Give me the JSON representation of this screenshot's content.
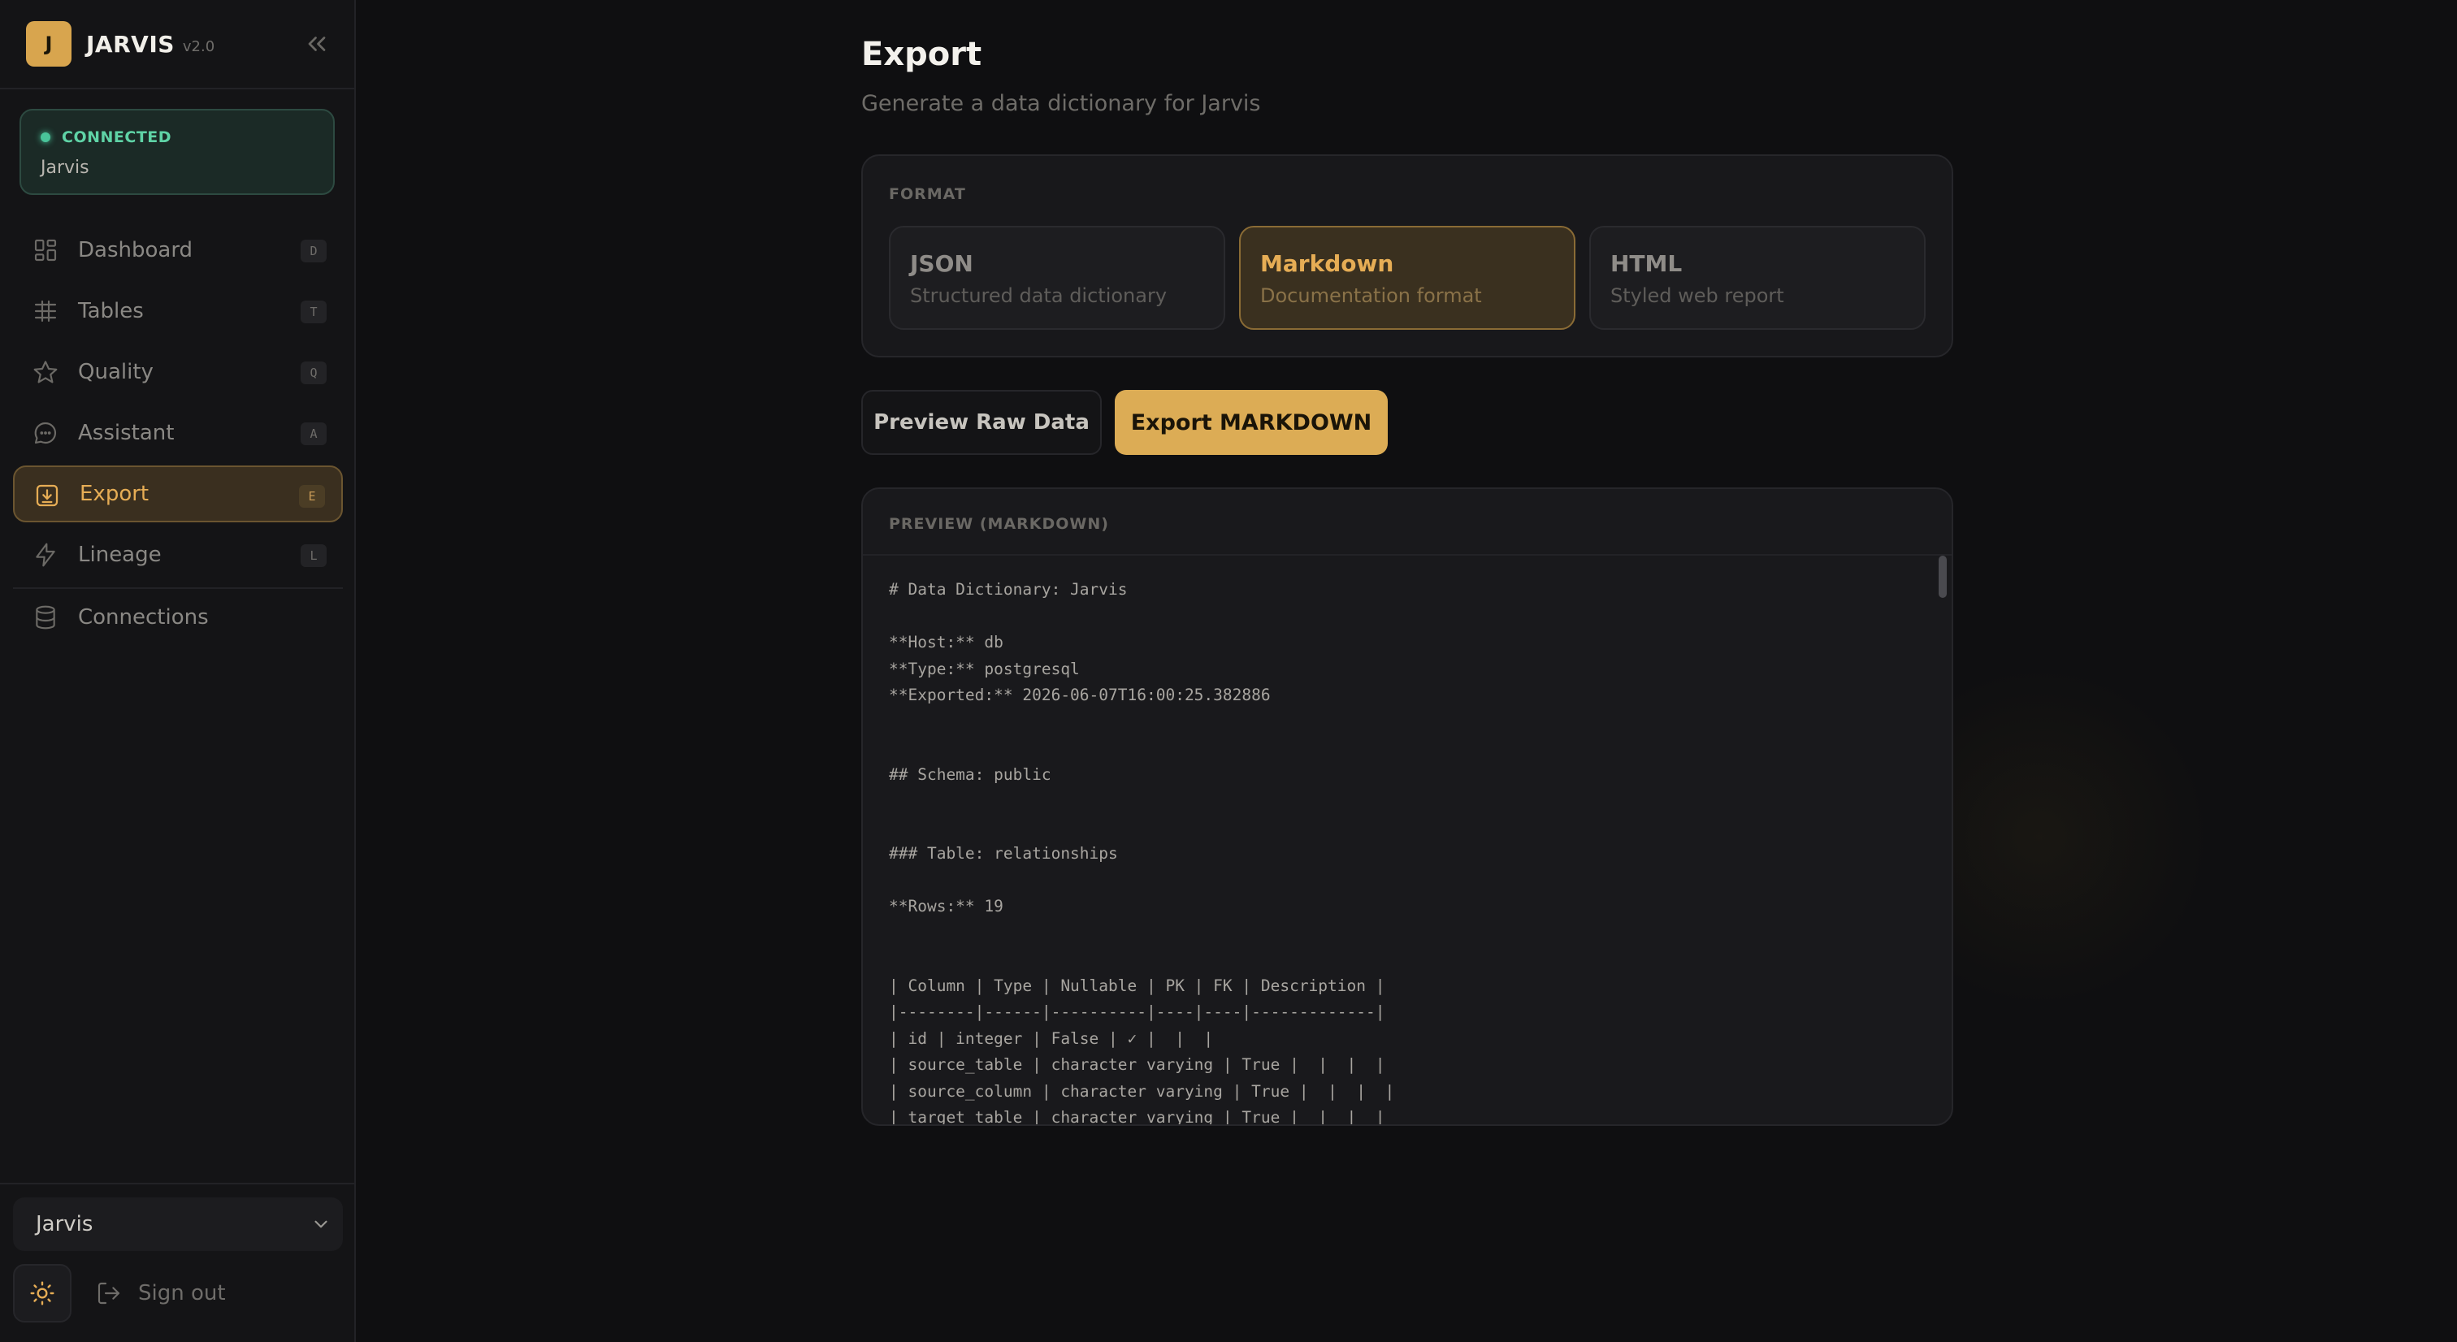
{
  "app": {
    "name": "JARVIS",
    "version": "v2.0",
    "logo_letter": "J"
  },
  "connection": {
    "status": "CONNECTED",
    "name": "Jarvis"
  },
  "nav": [
    {
      "label": "Dashboard",
      "shortcut": "D"
    },
    {
      "label": "Tables",
      "shortcut": "T"
    },
    {
      "label": "Quality",
      "shortcut": "Q"
    },
    {
      "label": "Assistant",
      "shortcut": "A"
    },
    {
      "label": "Export",
      "shortcut": "E",
      "active": true
    },
    {
      "label": "Lineage",
      "shortcut": "L"
    },
    {
      "label": "Connections",
      "shortcut": ""
    }
  ],
  "footer": {
    "database_selected": "Jarvis",
    "sign_out_label": "Sign out"
  },
  "page": {
    "title": "Export",
    "subtitle": "Generate a data dictionary for Jarvis"
  },
  "format": {
    "label": "FORMAT",
    "options": [
      {
        "title": "JSON",
        "description": "Structured data dictionary",
        "selected": false
      },
      {
        "title": "Markdown",
        "description": "Documentation format",
        "selected": true
      },
      {
        "title": "HTML",
        "description": "Styled web report",
        "selected": false
      }
    ]
  },
  "actions": {
    "preview_label": "Preview Raw Data",
    "export_label": "Export MARKDOWN"
  },
  "preview": {
    "label": "PREVIEW (MARKDOWN)",
    "content": "# Data Dictionary: Jarvis\n\n**Host:** db\n**Type:** postgresql\n**Exported:** 2026-06-07T16:00:25.382886\n\n\n## Schema: public\n\n\n### Table: relationships\n\n**Rows:** 19\n\n\n| Column | Type | Nullable | PK | FK | Description |\n|--------|------|----------|----|----|-------------|\n| id | integer | False | ✓ |  |  |\n| source_table | character varying | True |  |  |  |\n| source_column | character varying | True |  |  |  |\n| target_table | character varying | True |  |  |  |"
  },
  "colors": {
    "accent": "#dcac55",
    "connected": "#49c49a",
    "background": "#0f0f11",
    "sidebar": "#141416"
  }
}
